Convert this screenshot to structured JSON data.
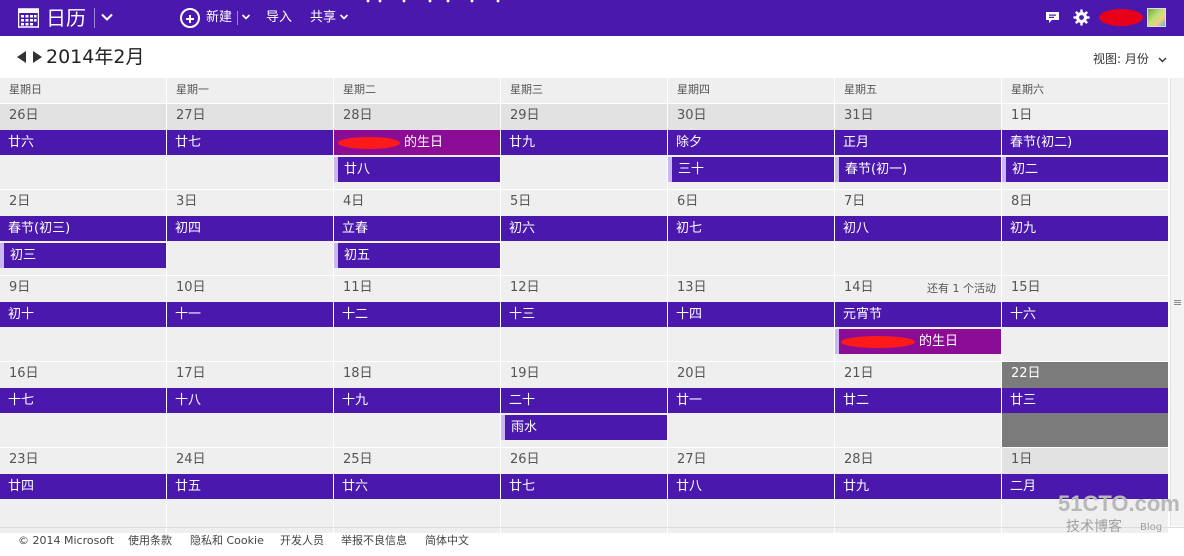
{
  "topbar": {
    "app_title": "日历",
    "new_label": "新建",
    "import_label": "导入",
    "share_label": "共享",
    "accent": "#4b18ad"
  },
  "header": {
    "month_title": "2014年2月",
    "view_label": "视图: 月份"
  },
  "weekdays": [
    "星期日",
    "星期一",
    "星期二",
    "星期三",
    "星期四",
    "星期五",
    "星期六"
  ],
  "weeks": [
    {
      "days": [
        {
          "label": "26日",
          "events": [
            "廿六"
          ]
        },
        {
          "label": "27日",
          "events": [
            "廿七"
          ]
        },
        {
          "label": "28日",
          "events": [
            "的生日",
            "廿八"
          ]
        },
        {
          "label": "29日",
          "events": [
            "廿九"
          ]
        },
        {
          "label": "30日",
          "events": [
            "除夕",
            "三十"
          ]
        },
        {
          "label": "31日",
          "events": [
            "正月",
            "春节(初一)"
          ]
        },
        {
          "label": "1日",
          "events": [
            "春节(初二)",
            "初二"
          ]
        }
      ]
    },
    {
      "days": [
        {
          "label": "2日",
          "events": [
            "春节(初三)",
            "初三"
          ]
        },
        {
          "label": "3日",
          "events": [
            "初四"
          ]
        },
        {
          "label": "4日",
          "events": [
            "立春",
            "初五"
          ]
        },
        {
          "label": "5日",
          "events": [
            "初六"
          ]
        },
        {
          "label": "6日",
          "events": [
            "初七"
          ]
        },
        {
          "label": "7日",
          "events": [
            "初八"
          ]
        },
        {
          "label": "8日",
          "events": [
            "初九"
          ]
        }
      ]
    },
    {
      "days": [
        {
          "label": "9日",
          "events": [
            "初十"
          ]
        },
        {
          "label": "10日",
          "events": [
            "十一"
          ]
        },
        {
          "label": "11日",
          "events": [
            "十二"
          ]
        },
        {
          "label": "12日",
          "events": [
            "十三"
          ]
        },
        {
          "label": "13日",
          "events": [
            "十四"
          ]
        },
        {
          "label": "14日",
          "more": "还有 1 个活动",
          "events": [
            "元宵节",
            "的生日"
          ]
        },
        {
          "label": "15日",
          "events": [
            "十六"
          ]
        }
      ]
    },
    {
      "days": [
        {
          "label": "16日",
          "events": [
            "十七"
          ]
        },
        {
          "label": "17日",
          "events": [
            "十八"
          ]
        },
        {
          "label": "18日",
          "events": [
            "十九"
          ]
        },
        {
          "label": "19日",
          "events": [
            "二十",
            "雨水"
          ]
        },
        {
          "label": "20日",
          "events": [
            "廿一"
          ]
        },
        {
          "label": "21日",
          "events": [
            "廿二"
          ]
        },
        {
          "label": "22日",
          "today": true,
          "events": [
            "廿三"
          ]
        }
      ]
    },
    {
      "days": [
        {
          "label": "23日",
          "events": [
            "廿四"
          ]
        },
        {
          "label": "24日",
          "events": [
            "廿五"
          ]
        },
        {
          "label": "25日",
          "events": [
            "廿六"
          ]
        },
        {
          "label": "26日",
          "events": [
            "廿七"
          ]
        },
        {
          "label": "27日",
          "events": [
            "廿八"
          ]
        },
        {
          "label": "28日",
          "events": [
            "廿九"
          ]
        },
        {
          "label": "1日",
          "events": [
            "二月"
          ]
        }
      ]
    }
  ],
  "footer": {
    "copyright": "© 2014 Microsoft",
    "terms": "使用条款",
    "privacy": "隐私和 Cookie",
    "developers": "开发人员",
    "report": "举报不良信息",
    "language": "简体中文"
  },
  "watermark": {
    "main": "51CTO.com",
    "sub": "技术博客",
    "blog": "Blog"
  }
}
